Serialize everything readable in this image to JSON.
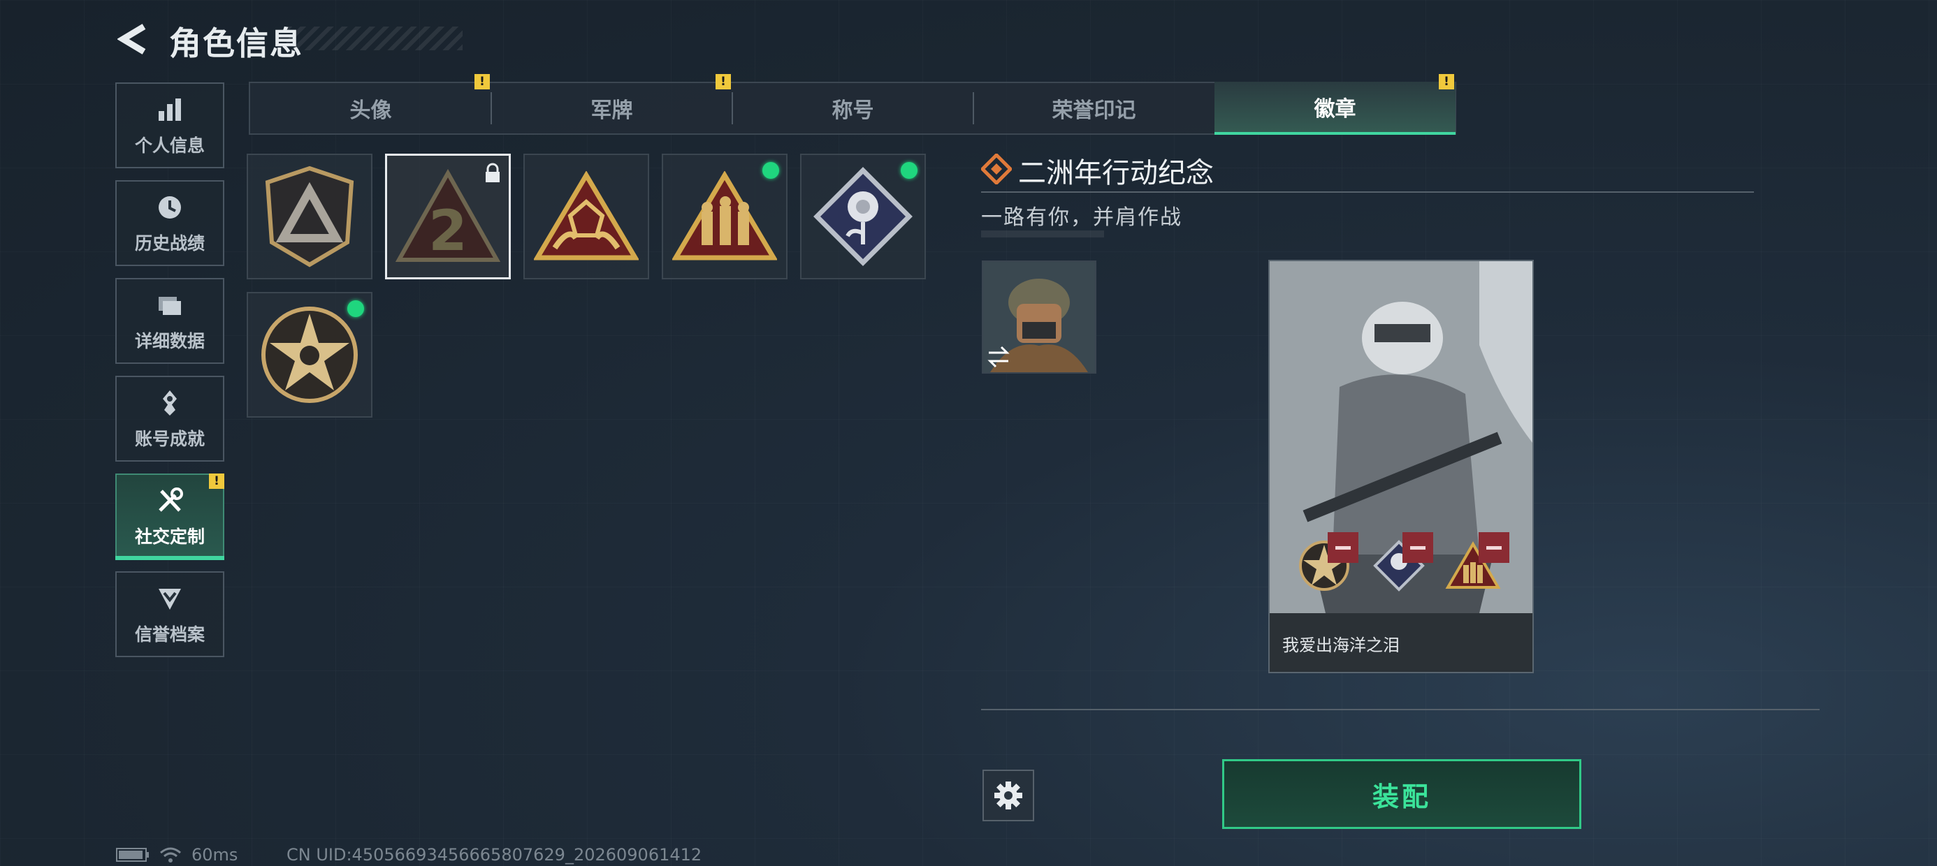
{
  "header": {
    "title": "角色信息"
  },
  "nav": [
    {
      "label": "个人信息",
      "icon": "bar-chart-icon",
      "active": false,
      "warn": false
    },
    {
      "label": "历史战绩",
      "icon": "clock-icon",
      "active": false,
      "warn": false
    },
    {
      "label": "详细数据",
      "icon": "folder-icon",
      "active": false,
      "warn": false
    },
    {
      "label": "账号成就",
      "icon": "medal-icon",
      "active": false,
      "warn": false
    },
    {
      "label": "社交定制",
      "icon": "tools-icon",
      "active": true,
      "warn": true
    },
    {
      "label": "信誉档案",
      "icon": "shield-chevron-icon",
      "active": false,
      "warn": false
    }
  ],
  "tabs": [
    {
      "label": "头像",
      "warn": true,
      "active": false
    },
    {
      "label": "军牌",
      "warn": true,
      "active": false
    },
    {
      "label": "称号",
      "warn": false,
      "active": false
    },
    {
      "label": "荣誉印记",
      "warn": false,
      "active": false
    },
    {
      "label": "徽章",
      "warn": true,
      "active": true
    }
  ],
  "warn_symbol": "!",
  "badges": [
    {
      "name": "shield-badge",
      "selected": false,
      "locked": false,
      "new": false
    },
    {
      "name": "number-2-badge",
      "selected": true,
      "locked": true,
      "new": false
    },
    {
      "name": "hands-crystal-badge",
      "selected": false,
      "locked": false,
      "new": false
    },
    {
      "name": "soldiers-badge",
      "selected": false,
      "locked": false,
      "new": true
    },
    {
      "name": "rose-badge",
      "selected": false,
      "locked": false,
      "new": true
    },
    {
      "name": "star-skull-badge",
      "selected": false,
      "locked": false,
      "new": true
    }
  ],
  "detail": {
    "name": "二洲年行动纪念",
    "description": "一路有你，并肩作战",
    "card_name": "我爱出海洋之泪",
    "equip_label": "装配"
  },
  "status": {
    "ping": "60ms",
    "uid": "CN UID:4505669345666580762​9_202609061412"
  },
  "colors": {
    "accent_green": "#3be39a",
    "warning_yellow": "#f0c93c",
    "new_dot": "#1fd67e",
    "remove_red": "#8a2b33"
  }
}
